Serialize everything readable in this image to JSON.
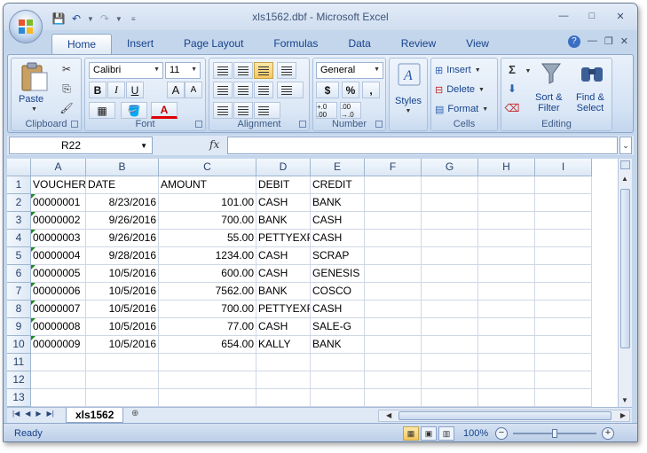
{
  "window": {
    "title": "xls1562.dbf - Microsoft Excel",
    "controls": {
      "minimize": "—",
      "maximize": "□",
      "close": "✕"
    },
    "ribbon_controls": {
      "help": "?",
      "minimize": "—",
      "restore": "❐",
      "close": "✕"
    }
  },
  "ribbon_tabs": [
    "Home",
    "Insert",
    "Page Layout",
    "Formulas",
    "Data",
    "Review",
    "View"
  ],
  "ribbon": {
    "clipboard": {
      "label": "Clipboard",
      "paste": "Paste"
    },
    "font": {
      "label": "Font",
      "name": "Calibri",
      "size": "11",
      "bold": "B",
      "italic": "I",
      "underline": "U",
      "grow": "A",
      "shrink": "A",
      "color_letter": "A"
    },
    "alignment": {
      "label": "Alignment"
    },
    "number": {
      "label": "Number",
      "format": "General",
      "currency": "$",
      "percent": "%",
      "comma": ",",
      "inc_decimal": "+.0 .00",
      "dec_decimal": ".00 →.0"
    },
    "styles": {
      "label": "Styles"
    },
    "cells": {
      "label": "Cells",
      "insert": "Insert",
      "delete": "Delete",
      "format": "Format"
    },
    "editing": {
      "label": "Editing",
      "sum": "Σ",
      "sort": "Sort &",
      "sort2": "Filter",
      "find": "Find &",
      "find2": "Select"
    }
  },
  "formula_bar": {
    "name_box": "R22",
    "fx": "fx",
    "value": ""
  },
  "columns": [
    {
      "label": "A",
      "w": 62
    },
    {
      "label": "B",
      "w": 82
    },
    {
      "label": "C",
      "w": 110
    },
    {
      "label": "D",
      "w": 61
    },
    {
      "label": "E",
      "w": 61
    },
    {
      "label": "F",
      "w": 64
    },
    {
      "label": "G",
      "w": 64
    },
    {
      "label": "H",
      "w": 64
    },
    {
      "label": "I",
      "w": 64
    }
  ],
  "rows": [
    {
      "n": "1",
      "cells": [
        "VOUCHER",
        "DATE",
        "AMOUNT",
        "DEBIT",
        "CREDIT"
      ],
      "align": [
        "l",
        "l",
        "l",
        "l",
        "l"
      ],
      "tri": false
    },
    {
      "n": "2",
      "cells": [
        "00000001",
        "8/23/2016",
        "101.00",
        "CASH",
        "BANK"
      ],
      "align": [
        "l",
        "r",
        "r",
        "l",
        "l"
      ],
      "tri": true
    },
    {
      "n": "3",
      "cells": [
        "00000002",
        "9/26/2016",
        "700.00",
        "BANK",
        "CASH"
      ],
      "align": [
        "l",
        "r",
        "r",
        "l",
        "l"
      ],
      "tri": true
    },
    {
      "n": "4",
      "cells": [
        "00000003",
        "9/26/2016",
        "55.00",
        "PETTYEXP",
        "CASH"
      ],
      "align": [
        "l",
        "r",
        "r",
        "l",
        "l"
      ],
      "tri": true
    },
    {
      "n": "5",
      "cells": [
        "00000004",
        "9/28/2016",
        "1234.00",
        "CASH",
        "SCRAP"
      ],
      "align": [
        "l",
        "r",
        "r",
        "l",
        "l"
      ],
      "tri": true
    },
    {
      "n": "6",
      "cells": [
        "00000005",
        "10/5/2016",
        "600.00",
        "CASH",
        "GENESIS"
      ],
      "align": [
        "l",
        "r",
        "r",
        "l",
        "l"
      ],
      "tri": true
    },
    {
      "n": "7",
      "cells": [
        "00000006",
        "10/5/2016",
        "7562.00",
        "BANK",
        "COSCO"
      ],
      "align": [
        "l",
        "r",
        "r",
        "l",
        "l"
      ],
      "tri": true
    },
    {
      "n": "8",
      "cells": [
        "00000007",
        "10/5/2016",
        "700.00",
        "PETTYEXP",
        "CASH"
      ],
      "align": [
        "l",
        "r",
        "r",
        "l",
        "l"
      ],
      "tri": true
    },
    {
      "n": "9",
      "cells": [
        "00000008",
        "10/5/2016",
        "77.00",
        "CASH",
        "SALE-G"
      ],
      "align": [
        "l",
        "r",
        "r",
        "l",
        "l"
      ],
      "tri": true
    },
    {
      "n": "10",
      "cells": [
        "00000009",
        "10/5/2016",
        "654.00",
        "KALLY",
        "BANK"
      ],
      "align": [
        "l",
        "r",
        "r",
        "l",
        "l"
      ],
      "tri": true
    },
    {
      "n": "11",
      "cells": [],
      "align": [],
      "tri": false
    },
    {
      "n": "12",
      "cells": [],
      "align": [],
      "tri": false
    },
    {
      "n": "13",
      "cells": [],
      "align": [],
      "tri": false
    }
  ],
  "sheet_tabs": [
    "xls1562"
  ],
  "status": {
    "ready": "Ready",
    "zoom": "100%"
  },
  "colors": {
    "accent": "#15428b",
    "error_triangle": "#1f8a1f"
  }
}
